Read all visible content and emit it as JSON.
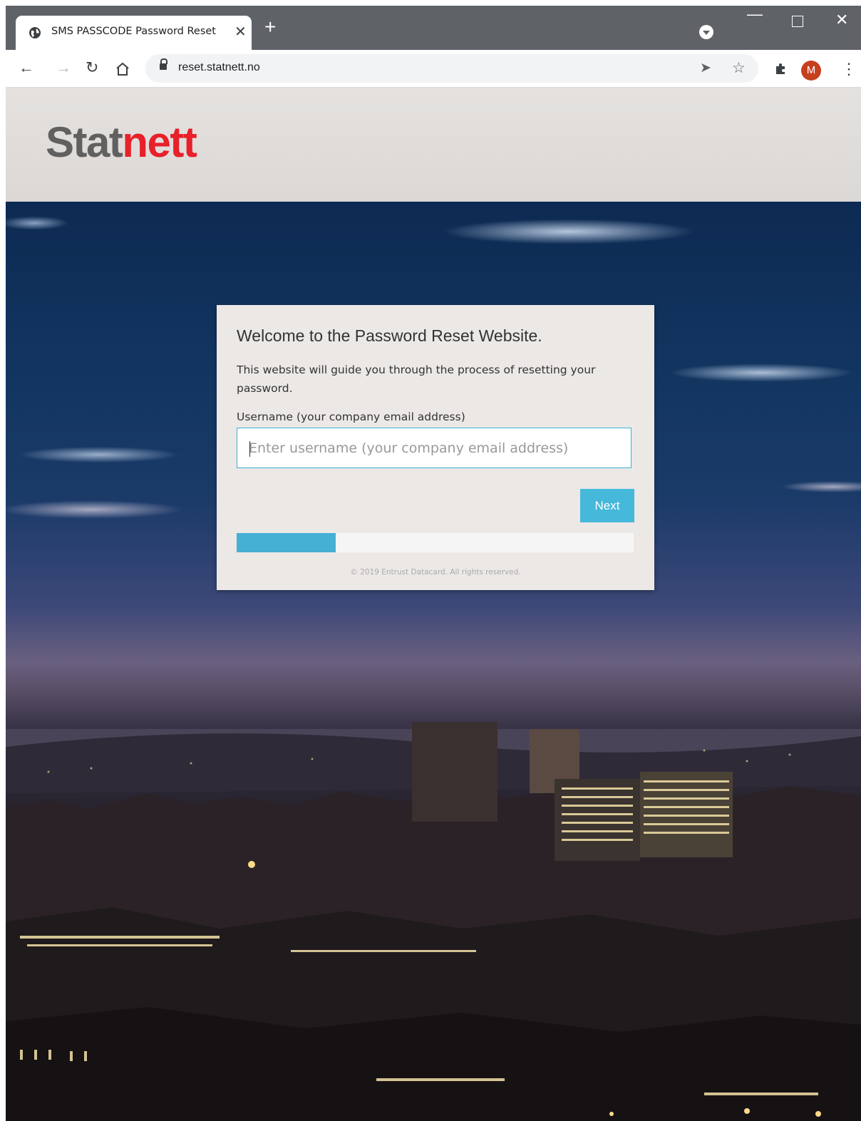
{
  "browser": {
    "tab_title": "SMS PASSCODE Password Reset",
    "tab_close": "✕",
    "new_tab": "+",
    "url": "reset.statnett.no",
    "profile_initial": "M",
    "icons": [
      "globe-icon",
      "close-icon",
      "plus-icon",
      "profile-dropdown-icon",
      "minimize-icon",
      "maximize-icon",
      "window-close-icon",
      "back-arrow-icon",
      "forward-arrow-icon",
      "reload-icon",
      "home-icon",
      "lock-icon",
      "send-icon",
      "star-icon",
      "extensions-icon",
      "kebab-menu-icon"
    ]
  },
  "header": {
    "logo_part1": "Stat",
    "logo_part2": "nett",
    "logo_color_1": "#606060",
    "logo_color_2": "#e8202a"
  },
  "card": {
    "title": "Welcome to the Password Reset Website.",
    "description": "This website will guide you through the process of resetting your password.",
    "username_label": "Username (your company email address)",
    "username_value": "",
    "username_placeholder": "Enter username (your company email address)",
    "next_label": "Next",
    "progress_fraction": 0.25,
    "copyright": "© 2019 Entrust Datacard. All rights reserved."
  },
  "colors": {
    "accent": "#46b8da",
    "input_border": "#3fb0d3"
  }
}
